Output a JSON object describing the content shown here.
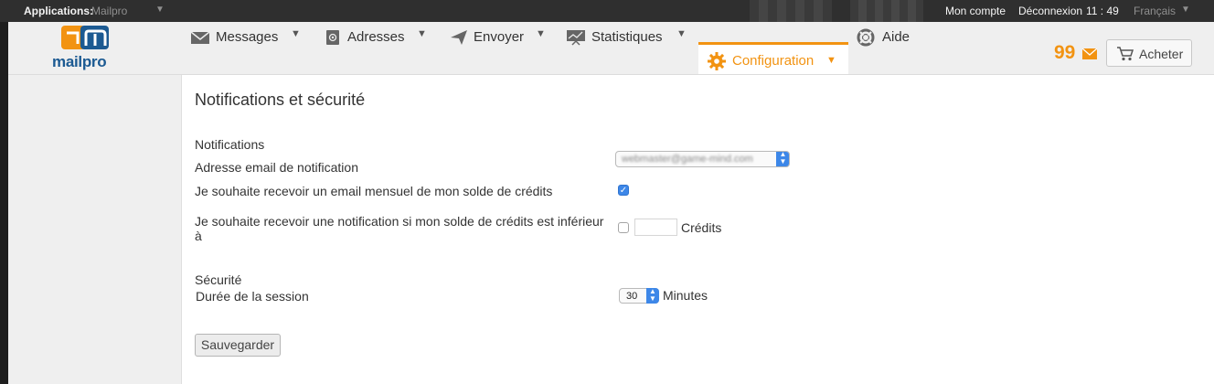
{
  "topbar": {
    "apps_label": "Applications:",
    "apps_value": "Mailpro",
    "account": "Mon compte",
    "logout": "Déconnexion",
    "clock": "11 : 49",
    "language": "Français"
  },
  "logo": {
    "text": "mailpro"
  },
  "nav": {
    "items": [
      {
        "label": "Messages",
        "icon": "envelope-icon"
      },
      {
        "label": "Adresses",
        "icon": "address-book-icon"
      },
      {
        "label": "Envoyer",
        "icon": "paper-plane-icon"
      },
      {
        "label": "Statistiques",
        "icon": "chart-board-icon"
      },
      {
        "label": "Configuration",
        "icon": "gear-icon",
        "active": true
      },
      {
        "label": "Aide",
        "icon": "lifebuoy-icon"
      }
    ]
  },
  "header": {
    "credits": "99",
    "buy_label": "Acheter"
  },
  "colors": {
    "accent": "#f29312",
    "brand_blue": "#1c5a92",
    "select_blue": "#3d87e8"
  },
  "page": {
    "title": "Notifications et sécurité",
    "notifications": {
      "heading": "Notifications",
      "email_label": "Adresse email de notification",
      "email_value": "webmaster@game-mind.com",
      "monthly_label": "Je souhaite recevoir un email mensuel de mon solde de crédits",
      "monthly_checked": true,
      "threshold_label_line1": "Je souhaite recevoir une notification si mon solde de crédits est inférieur",
      "threshold_label_line2": "à",
      "threshold_checked": false,
      "threshold_value": "",
      "credits_unit": "Crédits"
    },
    "security": {
      "heading": "Sécurité",
      "session_label": "Durée de la session",
      "session_value": "30",
      "session_unit": "Minutes"
    },
    "save_label": "Sauvegarder"
  }
}
